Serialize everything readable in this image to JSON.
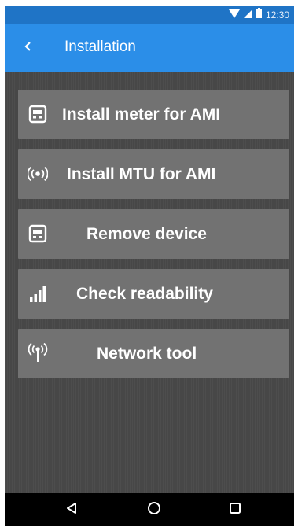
{
  "status_bar": {
    "time": "12:30",
    "icons": [
      "wifi-icon",
      "cell-signal-icon",
      "battery-icon"
    ]
  },
  "app_bar": {
    "back_icon": "back-chevron-icon",
    "title": "Installation"
  },
  "menu": {
    "items": [
      {
        "label": "Install meter for AMI",
        "icon": "meter-icon"
      },
      {
        "label": "Install MTU for AMI",
        "icon": "broadcast-icon"
      },
      {
        "label": "Remove device",
        "icon": "meter-icon"
      },
      {
        "label": "Check readability",
        "icon": "signal-bars-icon"
      },
      {
        "label": "Network tool",
        "icon": "antenna-icon"
      }
    ]
  },
  "nav_bar": {
    "icons": [
      "back-triangle-icon",
      "home-circle-icon",
      "recents-square-icon"
    ]
  },
  "colors": {
    "status_bar": "#1f74c6",
    "app_bar": "#2b8ee8",
    "content_bg": "#474747",
    "button_bg": "#727272",
    "nav_bar": "#000000"
  }
}
